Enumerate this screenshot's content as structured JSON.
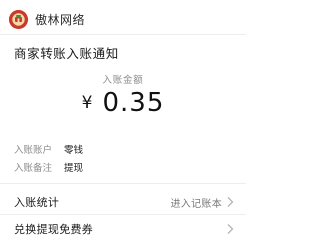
{
  "header": {
    "sender_name": "傲林网络",
    "avatar_icon": "company-logo-icon"
  },
  "notice": {
    "title": "商家转账入账通知"
  },
  "amount": {
    "label": "入账金额",
    "currency_symbol": "¥",
    "value": "0.35"
  },
  "details": [
    {
      "key": "入账账户",
      "value": "零钱"
    },
    {
      "key": "入账备注",
      "value": "提现"
    }
  ],
  "actions": [
    {
      "label": "入账统计",
      "hint": "进入记账本",
      "icon": "chevron-right-icon"
    },
    {
      "label": "兑换提现免费券",
      "hint": "",
      "icon": "chevron-right-icon"
    }
  ],
  "colors": {
    "avatar_bg": "#c93a2c",
    "muted_text": "#8c8c8c",
    "divider": "#ededed"
  }
}
